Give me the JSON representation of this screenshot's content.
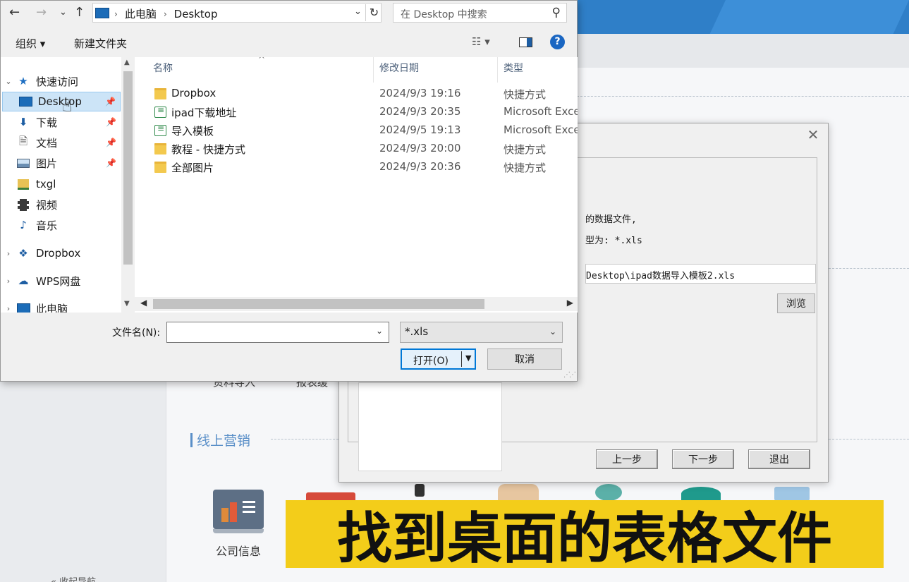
{
  "file_dialog": {
    "nav": {
      "back": "←",
      "forward": "→",
      "recent": "⌄",
      "up": "↑"
    },
    "address": {
      "crumbs": [
        "此电脑",
        "Desktop"
      ],
      "refresh": "↻"
    },
    "search": {
      "placeholder": "在 Desktop 中搜索"
    },
    "toolbar": {
      "organize": "组织 ▾",
      "new_folder": "新建文件夹",
      "view": "☷ ▾",
      "help": "?"
    },
    "nav_pane": {
      "items": [
        {
          "label": "快速访问",
          "icon": "star-icon"
        },
        {
          "label": "Desktop",
          "icon": "desktop-icon",
          "selected": true
        },
        {
          "label": "下载",
          "icon": "download-icon"
        },
        {
          "label": "文档",
          "icon": "document-icon"
        },
        {
          "label": "图片",
          "icon": "pictures-icon"
        },
        {
          "label": "txgl",
          "icon": "folder-icon"
        },
        {
          "label": "视频",
          "icon": "video-icon"
        },
        {
          "label": "音乐",
          "icon": "music-icon"
        },
        {
          "label": "Dropbox",
          "icon": "dropbox-icon"
        },
        {
          "label": "WPS网盘",
          "icon": "cloud-icon"
        },
        {
          "label": "此电脑",
          "icon": "computer-icon"
        }
      ]
    },
    "columns": {
      "name": "名称",
      "date": "修改日期",
      "type": "类型"
    },
    "files": [
      {
        "name": "Dropbox",
        "date": "2024/9/3 19:16",
        "type": "快捷方式",
        "icon": "folder-icon"
      },
      {
        "name": "ipad下载地址",
        "date": "2024/9/3 20:35",
        "type": "Microsoft Excel",
        "icon": "excel-icon"
      },
      {
        "name": "导入模板",
        "date": "2024/9/5 19:13",
        "type": "Microsoft Excel",
        "icon": "excel-icon"
      },
      {
        "name": "教程 - 快捷方式",
        "date": "2024/9/3 20:00",
        "type": "快捷方式",
        "icon": "folder-icon"
      },
      {
        "name": "全部图片",
        "date": "2024/9/3 20:36",
        "type": "快捷方式",
        "icon": "folder-icon"
      }
    ],
    "filename_label": "文件名(N):",
    "filename_value": "",
    "filter_value": "*.xls",
    "open_label": "打开(O)",
    "cancel_label": "取消"
  },
  "wizard": {
    "close": "✕",
    "line1": "的数据文件,",
    "line2": "型为: *.xls",
    "path_value": "Desktop\\ipad数据导入模板2.xls",
    "browse_label": "浏览",
    "prev_label": "上一步",
    "next_label": "下一步",
    "exit_label": "退出"
  },
  "background": {
    "partial_labels": [
      "资料导入",
      "报表缓"
    ],
    "section_title": "线上营销",
    "company_label": "公司信息",
    "collapse_label": "« 收起导航"
  },
  "caption": "找到桌面的表格文件",
  "colors": {
    "accent": "#0078d7",
    "caption_bg": "#f3cd1a",
    "section_blue": "#5a8fc8"
  }
}
